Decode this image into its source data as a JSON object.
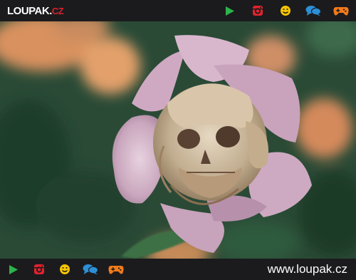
{
  "header": {
    "logo_main": "LOUPAK.",
    "logo_tld": "CZ"
  },
  "nav_icons": [
    {
      "name": "play-icon",
      "color": "#2db34a"
    },
    {
      "name": "instagram-icon",
      "color": "#e2222e"
    },
    {
      "name": "smiley-icon",
      "color": "#f5c400"
    },
    {
      "name": "chat-icon",
      "color": "#2d8fd6"
    },
    {
      "name": "gamepad-icon",
      "color": "#f07a1a"
    }
  ],
  "photo": {
    "subject": "wilted-rose-skull"
  },
  "footer": {
    "site_url": "www.loupak.cz"
  },
  "colors": {
    "bar_background": "#1b1b1d",
    "logo_accent": "#e0202b"
  }
}
